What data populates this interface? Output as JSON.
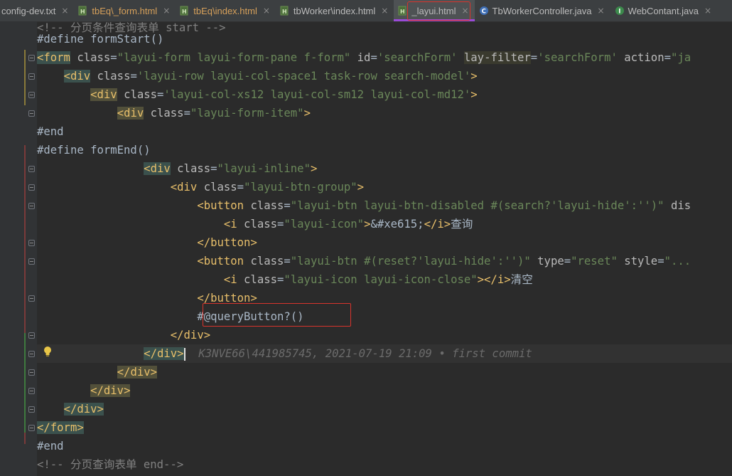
{
  "tabs": [
    {
      "label": "config-dev.txt",
      "icon": "text-file-icon",
      "close": "×"
    },
    {
      "label": "tbEq\\_form.html",
      "icon": "html-file-icon",
      "close": "×",
      "modified": true
    },
    {
      "label": "tbEq\\index.html",
      "icon": "html-file-icon",
      "close": "×",
      "modified": true
    },
    {
      "label": "tbWorker\\index.html",
      "icon": "html-file-icon",
      "close": "×"
    },
    {
      "label": "_layui.html",
      "icon": "html-file-icon",
      "close": "×",
      "active": true
    },
    {
      "label": "TbWorkerController.java",
      "icon": "java-class-icon",
      "close": "×"
    },
    {
      "label": "WebContant.java",
      "icon": "java-interface-icon",
      "close": "×"
    }
  ],
  "code": {
    "l0": "<!-- 分页条件查询表单 start -->",
    "l1": "#define formStart()",
    "l2_tag": "form",
    "l2_a1": "class",
    "l2_v1": "\"layui-form layui-form-pane f-form\"",
    "l2_a2": "id",
    "l2_v2": "'searchForm'",
    "l2_a3": "lay-filter",
    "l2_v3": "'searchForm'",
    "l2_a4": "action",
    "l2_v4": "\"ja",
    "l3_tag": "div",
    "l3_a1": "class",
    "l3_v1": "'layui-row layui-col-space1 task-row search-model'",
    "l4_tag": "div",
    "l4_a1": "class",
    "l4_v1": "'layui-col-xs12 layui-col-sm12 layui-col-md12'",
    "l5_tag": "div",
    "l5_a1": "class",
    "l5_v1": "\"layui-form-item\"",
    "l6": "#end",
    "l7": "#define formEnd()",
    "l8_tag": "div",
    "l8_a1": "class",
    "l8_v1": "\"layui-inline\"",
    "l9_tag": "div",
    "l9_a1": "class",
    "l9_v1": "\"layui-btn-group\"",
    "l10_tag": "button",
    "l10_a1": "class",
    "l10_v1": "\"layui-btn layui-btn-disabled #(search?'layui-hide':'')\"",
    "l10_rest": "dis",
    "l11_tag": "i",
    "l11_a1": "class",
    "l11_v1": "\"layui-icon\"",
    "l11_ent": "&#xe615;",
    "l11_text": "查询",
    "l12_tag": "button",
    "l13_tag": "button",
    "l13_a1": "class",
    "l13_v1": "\"layui-btn #(reset?'layui-hide':'')\"",
    "l13_a2": "type",
    "l13_v2": "\"reset\"",
    "l13_a3": "style",
    "l13_v3": "\"...",
    "l14_tag": "i",
    "l14_a1": "class",
    "l14_v1": "\"layui-icon layui-icon-close\"",
    "l14_text": "清空",
    "l15_tag": "button",
    "l16": "#@queryButton?()",
    "l17_tag": "div",
    "l18_tag": "div",
    "l18_blame": "K3NVE66\\441985745, 2021-07-19 21:09 • first commit",
    "l19_tag": "div",
    "l20_tag": "div",
    "l21_tag": "div",
    "l22_tag": "form",
    "l23": "#end",
    "l24": "<!-- 分页查询表单 end-->"
  }
}
